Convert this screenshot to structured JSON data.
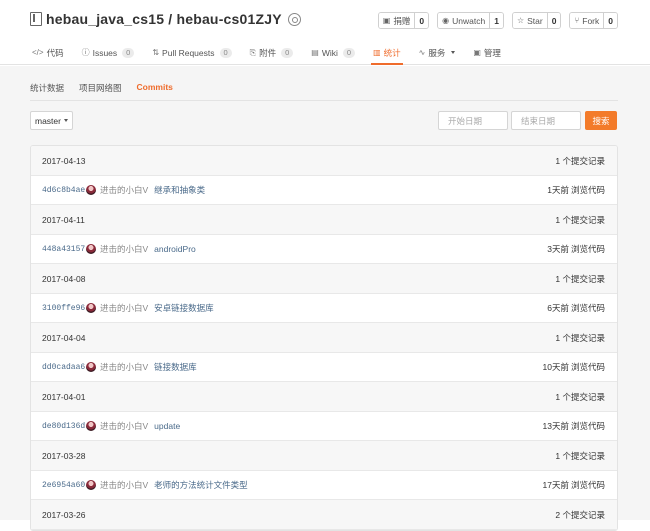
{
  "repo": {
    "title": "hebau_java_cs15 / hebau-cs01ZJY"
  },
  "actions": [
    {
      "label": "捐赠",
      "count": "0",
      "icon": "donate-icon"
    },
    {
      "label": "Unwatch",
      "count": "1",
      "icon": "eye-icon"
    },
    {
      "label": "Star",
      "count": "0",
      "icon": "star-icon"
    },
    {
      "label": "Fork",
      "count": "0",
      "icon": "fork-icon"
    }
  ],
  "nav": [
    {
      "label": "代码",
      "icon": "code-icon"
    },
    {
      "label": "Issues",
      "count": "0",
      "icon": "issue-icon"
    },
    {
      "label": "Pull Requests",
      "count": "0",
      "icon": "pull-request-icon"
    },
    {
      "label": "附件",
      "count": "0",
      "icon": "attachment-icon"
    },
    {
      "label": "Wiki",
      "count": "0",
      "icon": "wiki-icon"
    },
    {
      "label": "统计",
      "icon": "stats-icon",
      "active": true
    },
    {
      "label": "服务",
      "icon": "service-icon"
    },
    {
      "label": "管理",
      "icon": "admin-icon"
    }
  ],
  "subtabs": [
    {
      "label": "统计数据"
    },
    {
      "label": "项目网络图"
    },
    {
      "label": "Commits",
      "active": true
    }
  ],
  "filter": {
    "branch": "master",
    "start_placeholder": "开始日期",
    "end_placeholder": "结束日期",
    "search_label": "搜索"
  },
  "groups": [
    {
      "date": "2017-04-13",
      "count": "1 个提交记录",
      "commits": [
        {
          "sha": "4d6c8b4ae",
          "author": "进击的小白V",
          "message": "继承和抽象类",
          "time": "1天前",
          "browse": "浏览代码"
        }
      ]
    },
    {
      "date": "2017-04-11",
      "count": "1 个提交记录",
      "commits": [
        {
          "sha": "448a43157",
          "author": "进击的小白V",
          "message": "androidPro",
          "time": "3天前",
          "browse": "浏览代码"
        }
      ]
    },
    {
      "date": "2017-04-08",
      "count": "1 个提交记录",
      "commits": [
        {
          "sha": "3100ffe96",
          "author": "进击的小白V",
          "message": "安卓链接数据库",
          "time": "6天前",
          "browse": "浏览代码"
        }
      ]
    },
    {
      "date": "2017-04-04",
      "count": "1 个提交记录",
      "commits": [
        {
          "sha": "dd0cadaa6",
          "author": "进击的小白V",
          "message": "链接数据库",
          "time": "10天前",
          "browse": "浏览代码"
        }
      ]
    },
    {
      "date": "2017-04-01",
      "count": "1 个提交记录",
      "commits": [
        {
          "sha": "de80d136d",
          "author": "进击的小白V",
          "message": "update",
          "time": "13天前",
          "browse": "浏览代码"
        }
      ]
    },
    {
      "date": "2017-03-28",
      "count": "1 个提交记录",
      "commits": [
        {
          "sha": "2e6954a60",
          "author": "进击的小白V",
          "message": "老师的方法统计文件类型",
          "time": "17天前",
          "browse": "浏览代码"
        }
      ]
    },
    {
      "date": "2017-03-26",
      "count": "2 个提交记录",
      "commits": []
    }
  ]
}
